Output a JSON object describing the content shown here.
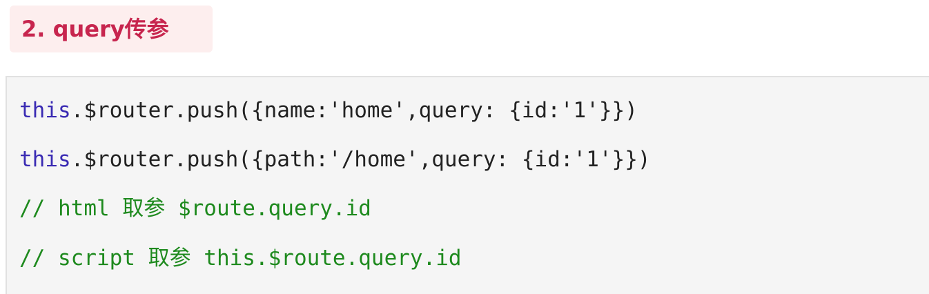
{
  "heading": {
    "text": "2. query传参"
  },
  "code": {
    "line1": {
      "keyword": "this",
      "rest": ".$router.push({name:'home',query: {id:'1'}})"
    },
    "line2": {
      "keyword": "this",
      "rest": ".$router.push({path:'/home',query: {id:'1'}})"
    },
    "line3": "// html 取参 $route.query.id",
    "line4": "// script 取参 this.$route.query.id"
  },
  "colors": {
    "heading_bg": "#fdeeee",
    "heading_text": "#c7254e",
    "code_bg": "#f5f5f5",
    "keyword": "#3a2bb3",
    "comment": "#1e8a1e",
    "text": "#222222"
  }
}
